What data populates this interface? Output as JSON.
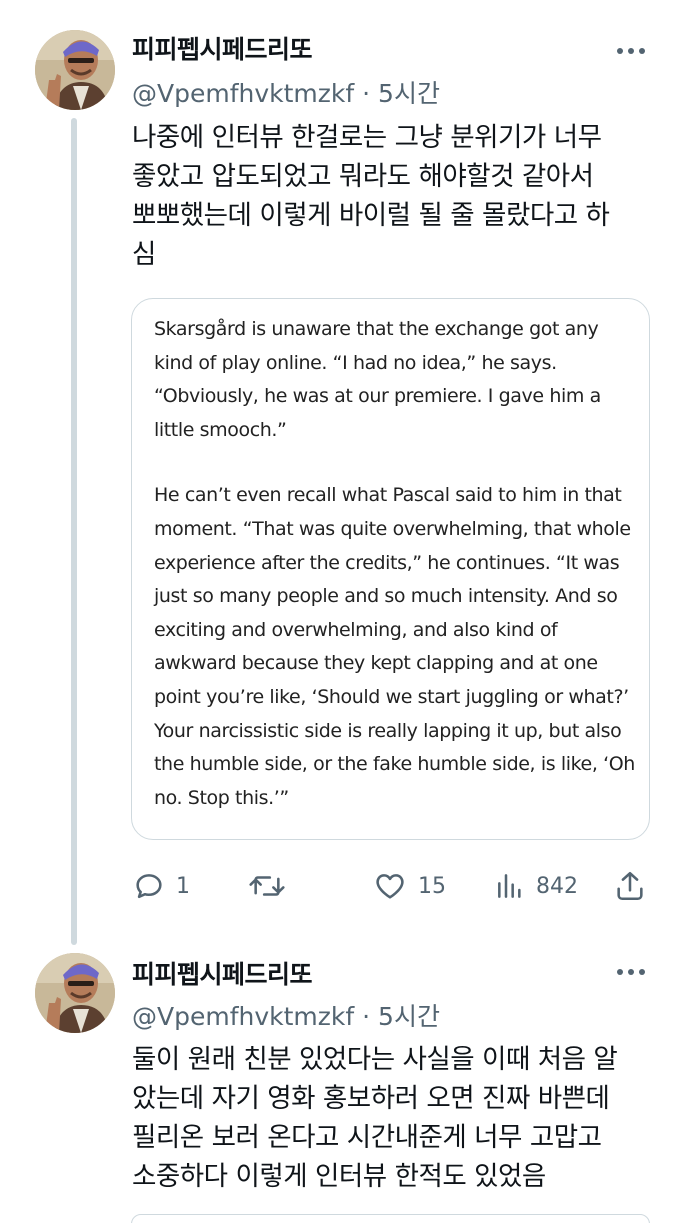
{
  "tweets": [
    {
      "author": {
        "display_name": "피피펩시페드리또",
        "handle": "@Vpemfhvktmzkf",
        "separator": "·",
        "time": "5시간"
      },
      "text": "나중에 인터뷰 한걸로는 그냥 분위기가 너무\n좋았고 압도되었고 뭐라도 해야할것 같아서\n뽀뽀했는데 이렇게 바이럴 될 줄 몰랐다고 하\n심",
      "quote_paragraphs": [
        "Skarsgård is unaware that the exchange got any kind of play online. “I had no idea,” he says. “Obviously, he was at our premiere. I gave him a little smooch.”",
        "He can’t even recall what Pascal said to him in that moment. “That was quite overwhelming, that whole experience after the credits,” he continues. “It was just so many people and so much intensity. And so exciting and overwhelming, and also kind of awkward because they kept clapping and at one point you’re like, ‘Should we start juggling or what?’ Your narcissistic side is really lapping it up, but also the humble side, or the fake humble side, is like, ‘Oh no. Stop this.’”"
      ],
      "actions": {
        "reply_count": "1",
        "retweet_count": "",
        "like_count": "15",
        "view_count": "842"
      }
    },
    {
      "author": {
        "display_name": "피피펩시페드리또",
        "handle": "@Vpemfhvktmzkf",
        "separator": "·",
        "time": "5시간"
      },
      "text": "둘이 원래 친분 있었다는 사실을 이때 처음 알\n았는데 자기 영화 홍보하러 오면 진짜 바쁜데\n필리온 보러 온다고 시간내준게 너무 고맙고\n소중하다 이렇게 인터뷰 한적도 있었음"
    }
  ],
  "icons": {
    "reply": "reply-icon",
    "retweet": "retweet-icon",
    "like": "heart-icon",
    "views": "views-icon",
    "share": "share-icon",
    "more": "more-icon"
  },
  "colors": {
    "text": "#0f1419",
    "secondary": "#536471",
    "border": "#cfd9de"
  }
}
